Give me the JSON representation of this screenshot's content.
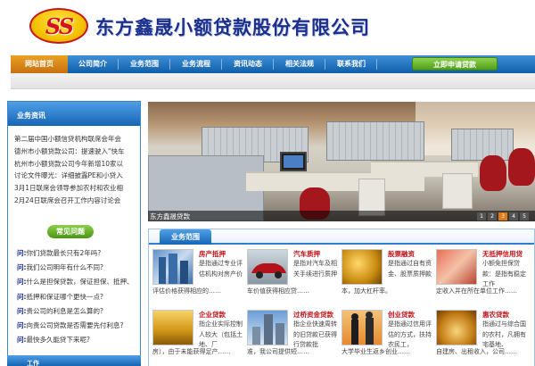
{
  "header": {
    "logo_text": "SS",
    "company_name": "东方鑫晟小额贷款股份有限公司"
  },
  "nav": {
    "items": [
      "网站首页",
      "公司简介",
      "业务范围",
      "业务流程",
      "资讯动态",
      "相关法规",
      "联系我们"
    ],
    "apply_button": "立即申请贷款"
  },
  "news": {
    "title": "业务资讯",
    "items": [
      "第二届中国小额信贷机构联席会年会",
      "德州市小额贷款公司：提速驶入\"快车",
      "杭州市小额贷款公司今年新增10家以",
      "讨论文件曝光：详细披露PE和小贷入",
      "3月1日联席会领导参加农村和农业相",
      "2月24日联席会召开工作内容讨论会"
    ]
  },
  "faq": {
    "title": "常见问题",
    "prefix": "问:",
    "items": [
      "你们贷款最长只有2年吗?",
      "我们公司明年有什么不同?",
      "什么是担保贷款，保证担保、抵押、",
      "抵押和保证哪个更快一点?",
      "贵公司的利息是怎么算的?",
      "向贵公司贷款是否需要先付利息?",
      "最快多久能贷下来呢?"
    ]
  },
  "left_bottom": {
    "label": "工作"
  },
  "banner": {
    "caption": "东方鑫晟贷款",
    "pages": [
      "1",
      "2",
      "3",
      "4",
      "5"
    ],
    "active_page": "3"
  },
  "services": {
    "tab_label": "业务范围",
    "items": [
      {
        "name": "房产抵押",
        "desc": "是指通过专业评估机构对房产价",
        "desc2": "评估价格获得相应的……",
        "thumb": "office-building"
      },
      {
        "name": "汽车质押",
        "desc": "是指对汽车及相关手续进行质押",
        "desc2": "车价值获得相应贷……",
        "thumb": "red-car"
      },
      {
        "name": "股票融资",
        "desc": "是指通过自有资金、股票质押款",
        "desc2": "本，加大杠杆率。",
        "thumb": "gold-coins"
      },
      {
        "name": "无抵押信用贷",
        "desc": "小额免担保贷款：是指有稳定工作",
        "desc2": "定收入并在所在单位工作……",
        "thumb": "cash-notes"
      },
      {
        "name": "企业贷款",
        "desc": "指企业实际控制人较大（包括土地、厂",
        "desc2": "房），由于未能获得足产……",
        "thumb": "gold-bars"
      },
      {
        "name": "过桥资金贷款",
        "desc": "指企业快速周转的旧贷款已获得行贷款批",
        "desc2": "准，我公司提供短……",
        "thumb": "city-tower"
      },
      {
        "name": "创业贷款",
        "desc": "是指通过信用评估的方式，扶持农民工，",
        "desc2": "大学毕业生返乡创业……",
        "thumb": "handshake"
      },
      {
        "name": "惠农贷款",
        "desc": "指通过与综合国的农村，凡拥有宅基地、",
        "desc2": "自建房、出租收入，公司……",
        "thumb": "coin-stacks"
      }
    ]
  },
  "colors": {
    "brand_blue": "#1565b5",
    "nav_active": "#eaa224",
    "apply_green": "#4f9e1a",
    "title_navy": "#1b2f8c",
    "service_red": "#c2161c"
  }
}
